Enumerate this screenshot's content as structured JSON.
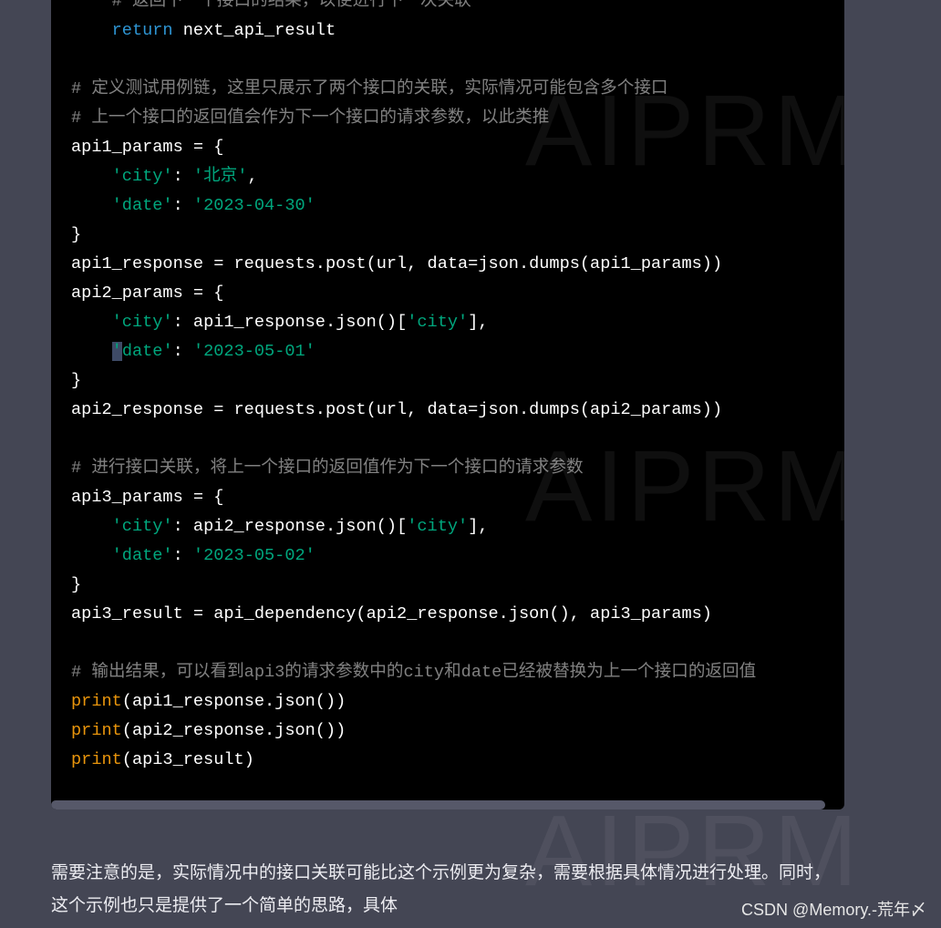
{
  "code_lines": [
    [
      [
        "cm",
        "    # 返回下一个接口的结果，以便进行下一次关联"
      ]
    ],
    [
      [
        "kw",
        "    return"
      ],
      [
        "tx",
        " next_api_result"
      ]
    ],
    [],
    [
      [
        "cm",
        "# 定义测试用例链，这里只展示了两个接口的关联，实际情况可能包含多个接口"
      ]
    ],
    [
      [
        "cm",
        "# 上一个接口的返回值会作为下一个接口的请求参数，以此类推"
      ]
    ],
    [
      [
        "tx",
        "api1_params = {"
      ]
    ],
    [
      [
        "tx",
        "    "
      ],
      [
        "str",
        "'city'"
      ],
      [
        "tx",
        ": "
      ],
      [
        "str",
        "'北京'"
      ],
      [
        "tx",
        ","
      ]
    ],
    [
      [
        "tx",
        "    "
      ],
      [
        "str",
        "'date'"
      ],
      [
        "tx",
        ": "
      ],
      [
        "str",
        "'2023-04-30'"
      ]
    ],
    [
      [
        "tx",
        "}"
      ]
    ],
    [
      [
        "tx",
        "api1_response = requests.post(url, data=json.dumps(api1_params))"
      ]
    ],
    [
      [
        "tx",
        "api2_params = {"
      ]
    ],
    [
      [
        "tx",
        "    "
      ],
      [
        "str",
        "'city'"
      ],
      [
        "tx",
        ": api1_response.json()["
      ],
      [
        "str",
        "'city'"
      ],
      [
        "tx",
        "],"
      ]
    ],
    [
      [
        "tx",
        "    "
      ],
      [
        "cursor",
        "'"
      ],
      [
        "str",
        "date'"
      ],
      [
        "tx",
        ": "
      ],
      [
        "str",
        "'2023-05-01'"
      ]
    ],
    [
      [
        "tx",
        "}"
      ]
    ],
    [
      [
        "tx",
        "api2_response = requests.post(url, data=json.dumps(api2_params))"
      ]
    ],
    [],
    [
      [
        "cm",
        "# 进行接口关联，将上一个接口的返回值作为下一个接口的请求参数"
      ]
    ],
    [
      [
        "tx",
        "api3_params = {"
      ]
    ],
    [
      [
        "tx",
        "    "
      ],
      [
        "str",
        "'city'"
      ],
      [
        "tx",
        ": api2_response.json()["
      ],
      [
        "str",
        "'city'"
      ],
      [
        "tx",
        "],"
      ]
    ],
    [
      [
        "tx",
        "    "
      ],
      [
        "str",
        "'date'"
      ],
      [
        "tx",
        ": "
      ],
      [
        "str",
        "'2023-05-02'"
      ]
    ],
    [
      [
        "tx",
        "}"
      ]
    ],
    [
      [
        "tx",
        "api3_result = api_dependency(api2_response.json(), api3_params)"
      ]
    ],
    [],
    [
      [
        "cm",
        "# 输出结果，可以看到api3的请求参数中的city和date已经被替换为上一个接口的返回值"
      ]
    ],
    [
      [
        "bi",
        "print"
      ],
      [
        "tx",
        "(api1_response.json())"
      ]
    ],
    [
      [
        "bi",
        "print"
      ],
      [
        "tx",
        "(api2_response.json())"
      ]
    ],
    [
      [
        "bi",
        "print"
      ],
      [
        "tx",
        "(api3_result)"
      ]
    ]
  ],
  "watermark": "AIPRM",
  "paragraph": "需要注意的是，实际情况中的接口关联可能比这个示例更为复杂，需要根据具体情况进行处理。同时，这个示例也只是提供了一个简单的思路，具体",
  "csdn_watermark": "CSDN @Memory.-荒年〆",
  "colors": {
    "background": "#444654",
    "code_bg": "#000000",
    "keyword": "#2e95d3",
    "string": "#00a67d",
    "builtin": "#e9950c",
    "scrollbar": "#565869"
  }
}
